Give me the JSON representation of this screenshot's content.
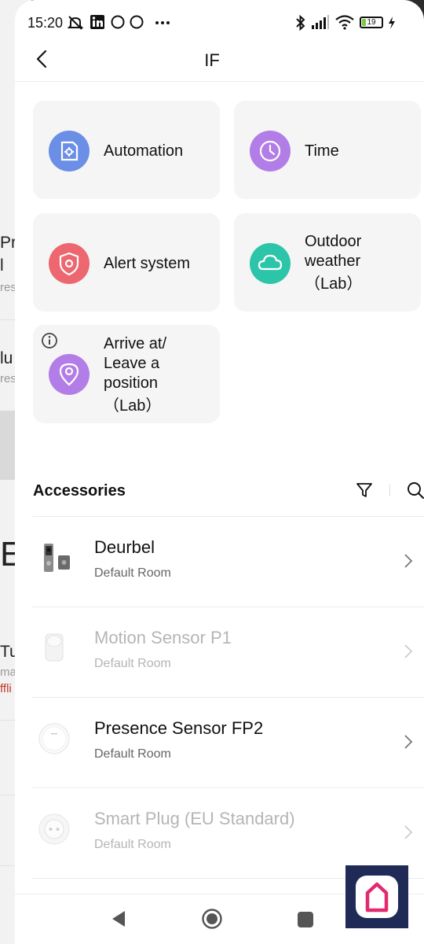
{
  "background_app": {
    "lines": [
      "Pre",
      "l",
      "res",
      "lu",
      "res",
      "E",
      "Tur",
      "ma",
      "ffli"
    ]
  },
  "status_bar": {
    "time": "15:20",
    "battery": "19",
    "icons": [
      "mute-icon",
      "linkedin-icon",
      "circle-icon",
      "circle-icon",
      "more-dots-icon",
      "bluetooth-icon",
      "signal-icon",
      "wifi-icon",
      "battery-icon",
      "charging-icon"
    ]
  },
  "header": {
    "title": "IF",
    "back_icon": "back-arrow-icon"
  },
  "conditions": [
    {
      "label": "Automation",
      "icon": "automation-icon",
      "color": "#6b8fe6"
    },
    {
      "label": "Time",
      "icon": "clock-icon",
      "color": "#b27de6"
    },
    {
      "label": "Alert system",
      "icon": "shield-icon",
      "color": "#ec6770"
    },
    {
      "label_lines": [
        "Outdoor",
        "weather",
        "（Lab）"
      ],
      "icon": "cloud-icon",
      "color": "#2dc5a9"
    },
    {
      "label_lines": [
        "Arrive at/",
        "Leave a",
        "position",
        "（Lab）"
      ],
      "icon": "location-pin-icon",
      "color": "#b27de6",
      "info_icon": "info-icon"
    }
  ],
  "accessories": {
    "title": "Accessories",
    "filter_icon": "filter-icon",
    "search_icon": "search-icon",
    "items": [
      {
        "name": "Deurbel",
        "room": "Default Room",
        "icon": "doorbell-icon",
        "enabled": true
      },
      {
        "name": "Motion Sensor P1",
        "room": "Default Room",
        "icon": "motion-sensor-icon",
        "enabled": false
      },
      {
        "name": "Presence Sensor FP2",
        "room": "Default Room",
        "icon": "presence-sensor-icon",
        "enabled": true
      },
      {
        "name": "Smart Plug (EU Standard)",
        "room": "Default Room",
        "icon": "smart-plug-icon",
        "enabled": false
      }
    ]
  },
  "nav": {
    "icons": [
      "nav-back-icon",
      "nav-home-icon",
      "nav-recents-icon"
    ]
  },
  "floating_app": {
    "icon": "home-app-icon",
    "color": "#1f2a57"
  }
}
